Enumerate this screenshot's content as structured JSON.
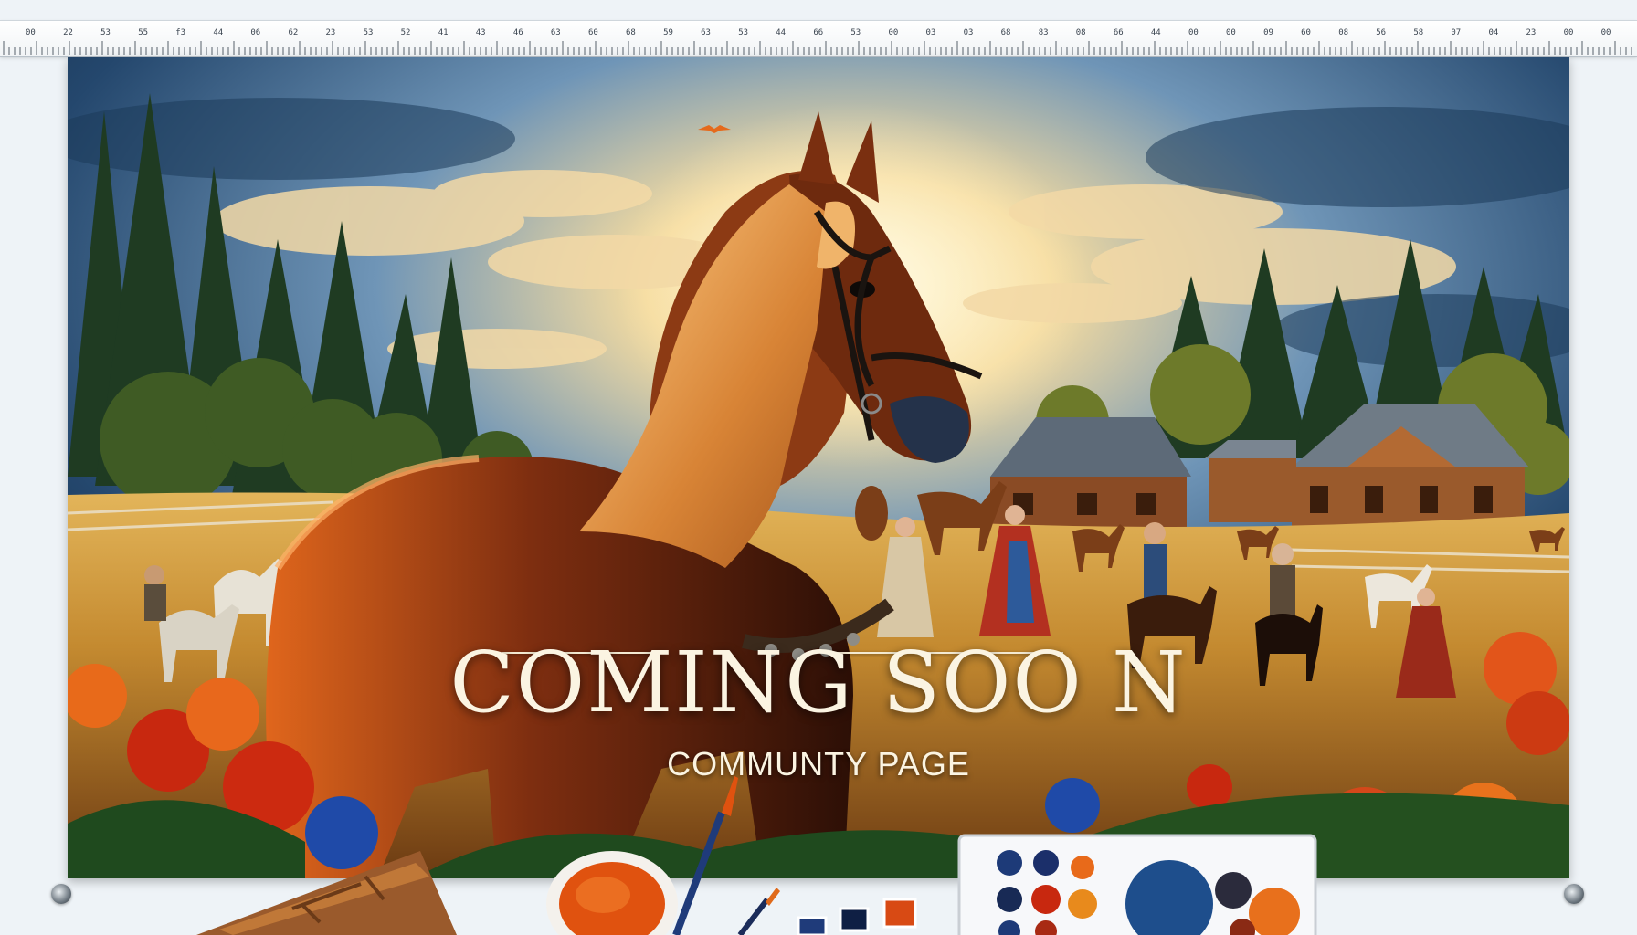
{
  "banner": {
    "title": "COMING SOO N",
    "subtitle": "COMMUNTY PAGE"
  },
  "ruler": {
    "labels": [
      "00",
      "22",
      "53",
      "55",
      "f3",
      "44",
      "06",
      "62",
      "23",
      "53",
      "52",
      "41",
      "43",
      "46",
      "63",
      "60",
      "68",
      "59",
      "63",
      "53",
      "44",
      "66",
      "53",
      "00",
      "03",
      "03",
      "68",
      "83",
      "08",
      "66",
      "44",
      "00",
      "00",
      "09",
      "60",
      "08",
      "56",
      "58",
      "07",
      "04",
      "23",
      "00",
      "00"
    ]
  },
  "colors": {
    "sky_top": "#163a5e",
    "sun_glow": "#fff4cf",
    "horse": "#8a3a12",
    "mane": "#e8a55a",
    "field": "#c68a2c",
    "title_text": "#fbf4e2"
  }
}
